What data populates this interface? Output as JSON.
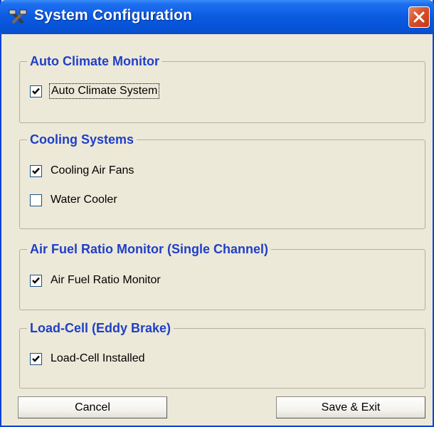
{
  "window": {
    "title": "System Configuration",
    "close_icon": "close-icon",
    "app_icon": "tools-icon"
  },
  "groups": [
    {
      "title": "Auto Climate Monitor",
      "items": [
        {
          "label": "Auto Climate System",
          "checked": true,
          "focused": true
        }
      ]
    },
    {
      "title": "Cooling Systems",
      "items": [
        {
          "label": "Cooling Air Fans",
          "checked": true
        },
        {
          "label": "Water Cooler",
          "checked": false
        }
      ]
    },
    {
      "title": "Air Fuel Ratio Monitor (Single Channel)",
      "items": [
        {
          "label": "Air Fuel Ratio Monitor",
          "checked": true
        }
      ]
    },
    {
      "title": "Load-Cell (Eddy Brake)",
      "items": [
        {
          "label": "Load-Cell Installed",
          "checked": true
        }
      ]
    }
  ],
  "buttons": {
    "cancel": "Cancel",
    "save": "Save & Exit"
  },
  "colors": {
    "title_bar": "#0a5ae0",
    "group_title": "#1f3fc7",
    "close_button": "#d8502a",
    "background": "#ece9d8"
  }
}
